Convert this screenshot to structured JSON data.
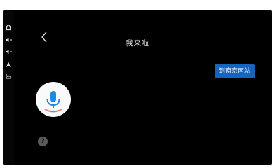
{
  "assistant": {
    "title": "我来啦",
    "message": "到南京南站",
    "help_symbol": "?"
  },
  "sidebar": {
    "icons": [
      "home-icon",
      "volume-up-icon",
      "volume-down-icon",
      "navigation-icon",
      "back-icon"
    ]
  },
  "colors": {
    "background": "#000000",
    "bubble": "#1565c0",
    "mic_blue": "#1e88e5"
  }
}
